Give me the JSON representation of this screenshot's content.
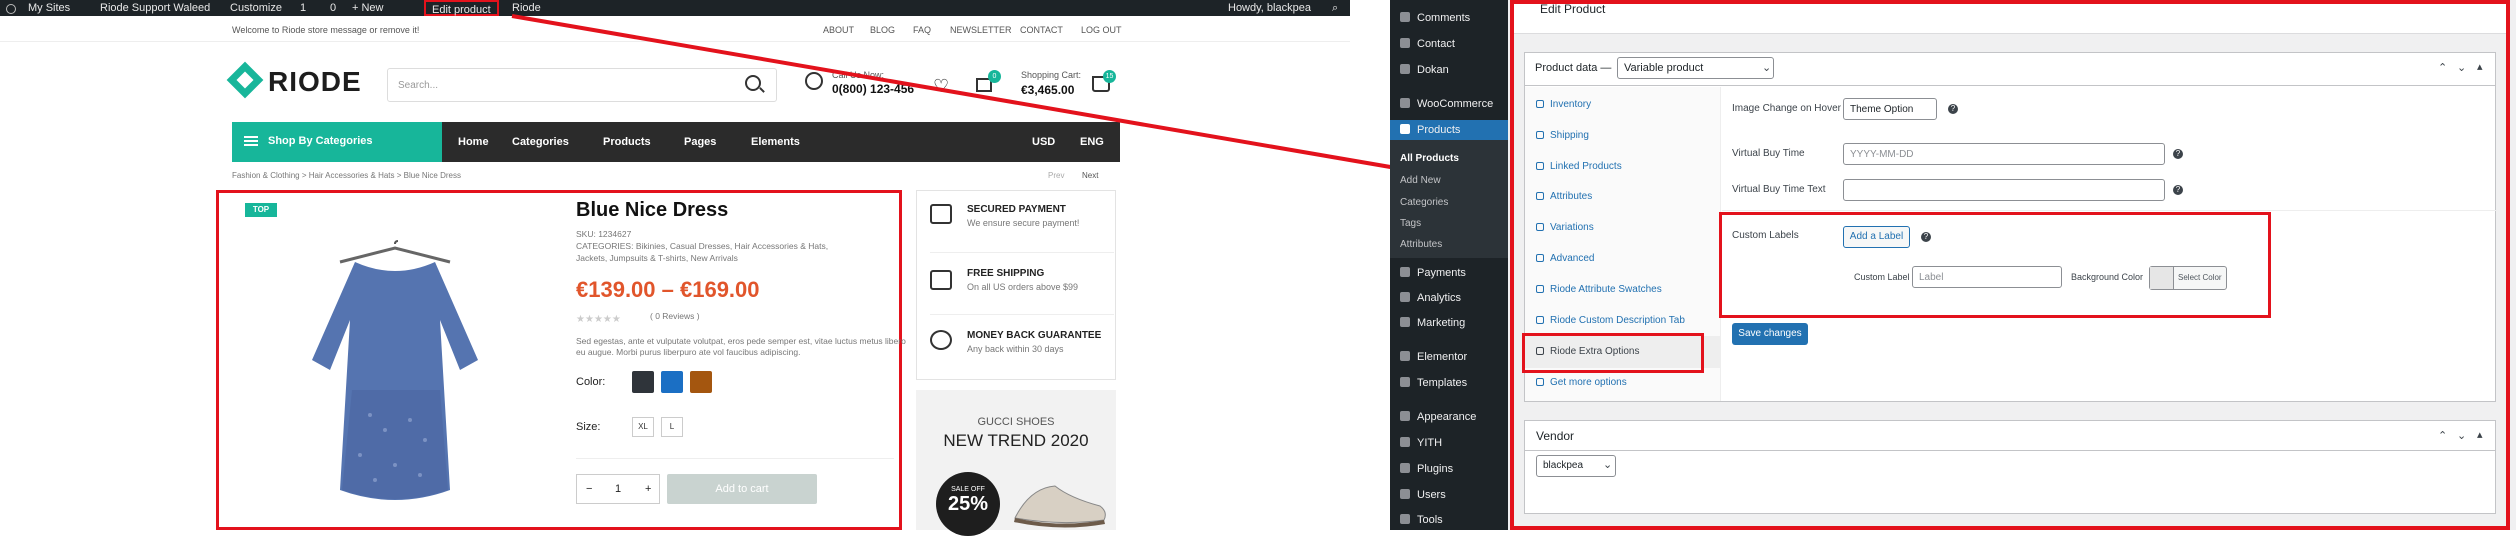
{
  "colors": {
    "accent": "#17b69a",
    "price": "#e1552b",
    "highlight": "#e3121c",
    "wp_dark": "#1d2327",
    "wp_blue": "#2271b1"
  },
  "wp_admin_bar": {
    "items": [
      "My Sites",
      "Riode Support Waleed",
      "Customize",
      "1",
      "0",
      "+ New",
      "Edit product",
      "Riode"
    ],
    "howdy": "Howdy, blackpea"
  },
  "store": {
    "welcome": "Welcome to Riode store message or remove it!",
    "top_links": [
      "ABOUT",
      "BLOG",
      "FAQ",
      "NEWSLETTER",
      "CONTACT",
      "LOG OUT"
    ],
    "logo": "RIODE",
    "search_placeholder": "Search...",
    "call_label": "Call Us Now:",
    "call_number": "0(800) 123-456",
    "compare_badge": "0",
    "cart_label": "Shopping Cart:",
    "cart_total": "€3,465.00",
    "cart_badge": "15",
    "nav": {
      "categories_button": "Shop By Categories",
      "items": [
        "Home",
        "Categories",
        "Products",
        "Pages",
        "Elements"
      ],
      "currency": "USD",
      "language": "ENG"
    },
    "breadcrumb": "Fashion & Clothing  >  Hair Accessories & Hats  >  Blue Nice Dress",
    "pager_prev": "Prev",
    "pager_next": "Next",
    "product": {
      "badge": "TOP",
      "title": "Blue Nice Dress",
      "sku": "SKU: 1234627",
      "categories_1": "CATEGORIES: Bikinies, Casual Dresses, Hair Accessories & Hats,",
      "categories_2": "Jackets, Jumpsuits & T-shirts, New Arrivals",
      "price": "€139.00 – €169.00",
      "reviews": "( 0 Reviews )",
      "desc_1": "Sed egestas, ante et vulputate volutpat, eros pede semper est, vitae luctus metus libero",
      "desc_2": "eu augue. Morbi purus liberpuro ate vol faucibus adipiscing.",
      "color_label": "Color:",
      "swatches": [
        "#2f343a",
        "#1b6fc4",
        "#a4560f"
      ],
      "size_label": "Size:",
      "sizes": [
        "XL",
        "L"
      ],
      "qty_minus": "−",
      "qty_value": "1",
      "qty_plus": "+",
      "add_to_cart": "Add to cart"
    },
    "features": [
      {
        "title": "SECURED PAYMENT",
        "sub": "We ensure secure payment!"
      },
      {
        "title": "FREE SHIPPING",
        "sub": "On all US orders above $99"
      },
      {
        "title": "MONEY BACK GUARANTEE",
        "sub": "Any back within 30 days"
      }
    ],
    "promo": {
      "sub": "GUCCI SHOES",
      "title": "NEW TREND 2020",
      "sale": "SALE OFF",
      "percent": "25%"
    }
  },
  "admin": {
    "sidebar": {
      "items": [
        {
          "label": "Comments"
        },
        {
          "label": "Contact"
        },
        {
          "label": "Dokan"
        },
        {
          "label": "WooCommerce"
        },
        {
          "label": "Products"
        }
      ],
      "sub_items": [
        "All Products",
        "Add New",
        "Categories",
        "Tags",
        "Attributes"
      ],
      "items_lower": [
        {
          "label": "Payments"
        },
        {
          "label": "Analytics"
        },
        {
          "label": "Marketing"
        },
        {
          "label": "Elementor"
        },
        {
          "label": "Templates"
        },
        {
          "label": "Appearance"
        },
        {
          "label": "YITH"
        },
        {
          "label": "Plugins"
        },
        {
          "label": "Users"
        },
        {
          "label": "Tools"
        }
      ]
    },
    "page_title": "Edit Product",
    "product_data": {
      "label": "Product data —",
      "type": "Variable product",
      "tabs": [
        "Inventory",
        "Shipping",
        "Linked Products",
        "Attributes",
        "Variations",
        "Advanced",
        "Riode Attribute Swatches",
        "Riode Custom Description Tab",
        "Riode Extra Options",
        "Get more options"
      ],
      "fields": {
        "image_change_label": "Image Change on Hover",
        "image_change_value": "Theme Option",
        "virtual_buy_time_label": "Virtual Buy Time",
        "virtual_buy_time_placeholder": "YYYY-MM-DD",
        "virtual_buy_time_text_label": "Virtual Buy Time Text",
        "custom_labels_label": "Custom Labels",
        "add_label_button": "Add a Label",
        "custom_label_label": "Custom Label",
        "custom_label_placeholder": "Label",
        "background_color_label": "Background Color",
        "select_color": "Select Color"
      },
      "save_button": "Save changes"
    },
    "vendor": {
      "title": "Vendor",
      "value": "blackpea"
    }
  }
}
